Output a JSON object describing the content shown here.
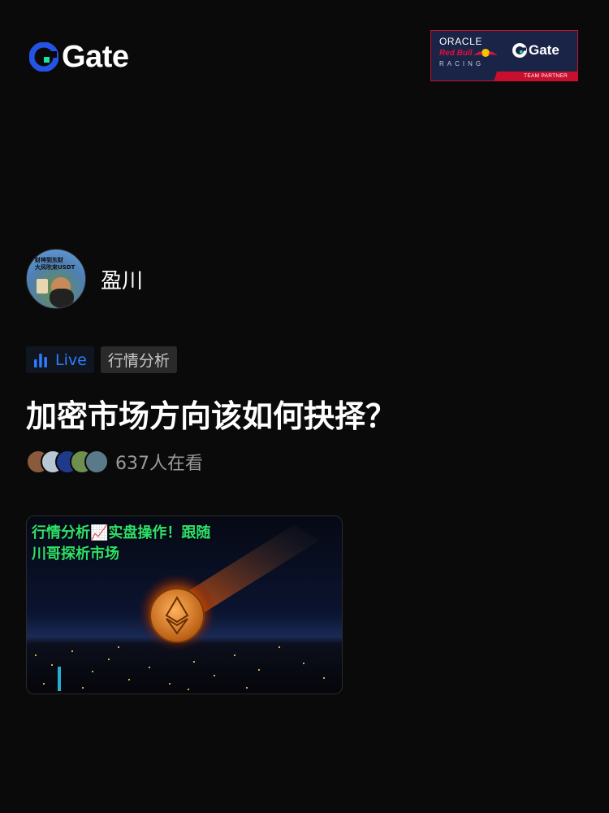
{
  "header": {
    "logo_text": "Gate",
    "partner": {
      "oracle": "ORACLE",
      "redbull": "Red Bull",
      "racing": "RACING",
      "gate_text": "Gate",
      "strip": "TEAM PARTNER"
    }
  },
  "host": {
    "name": "盈川",
    "avatar_caption_line1": "财神到东财",
    "avatar_caption_line2": "大风吹来USDT"
  },
  "tags": {
    "live_label": "Live",
    "category": "行情分析"
  },
  "stream": {
    "title": "加密市场方向该如何抉择？",
    "viewers_text": "637人在看",
    "thumbnail_caption_line1": "行情分析📈实盘操作！跟随",
    "thumbnail_caption_line2": "川哥探析市场"
  },
  "colors": {
    "background": "#0a0a0a",
    "live_blue": "#2f7bff",
    "gate_blue": "#2354e6",
    "gate_green": "#17e6a1",
    "thumbnail_text_green": "#2fe06a",
    "muted_text": "#9a9a9a"
  },
  "icons": {
    "logo": "gate-logo-icon",
    "live": "bar-chart-icon",
    "redbull": "red-bull-icon"
  },
  "viewer_avatar_colors": [
    "#8a5a3c",
    "#b9c6d3",
    "#1f3a8a",
    "#6e8f4e",
    "#5a7a8a"
  ]
}
